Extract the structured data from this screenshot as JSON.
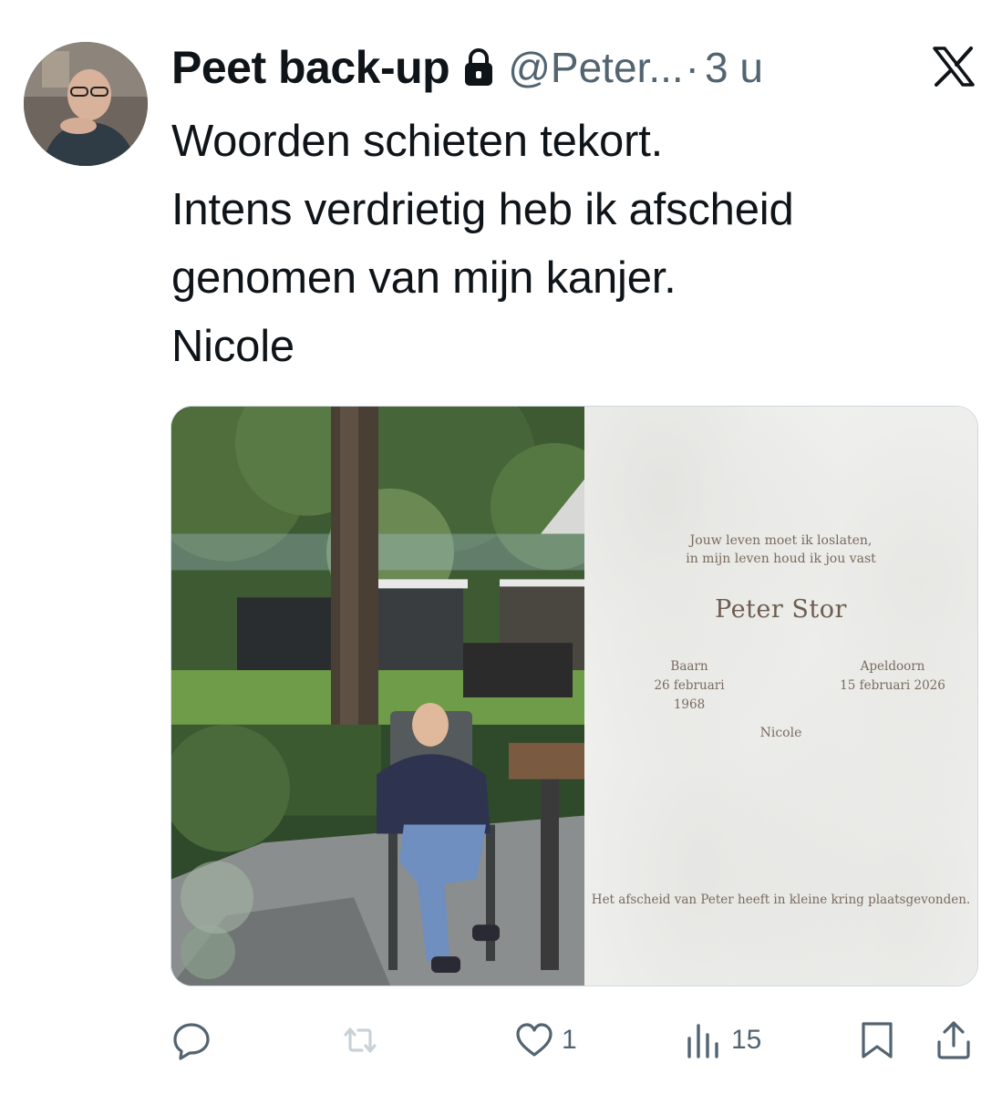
{
  "tweet": {
    "display_name": "Peet back-up",
    "handle": "@Peter...",
    "separator": "·",
    "time": "3 u",
    "text_lines": [
      "Woorden schieten tekort.",
      "Intens verdrietig heb ik afscheid",
      "genomen van mijn kanjer.",
      "Nicole"
    ]
  },
  "card": {
    "poem_line_1": "Jouw leven moet ik loslaten,",
    "poem_line_2": "in mijn leven houd ik jou vast",
    "name": "Peter Stor",
    "birth_place": "Baarn",
    "birth_date": "26 februari 1968",
    "death_place": "Apeldoorn",
    "death_date": "15 februari 2026",
    "signer": "Nicole",
    "closing": "Het afscheid van Peter heeft in kleine kring plaatsgevonden."
  },
  "actions": {
    "replies": "",
    "reposts": "",
    "likes": "1",
    "views": "15"
  },
  "icons": {
    "lock": "lock-icon",
    "x": "x-logo-icon",
    "reply": "reply-icon",
    "repost": "repost-icon",
    "like": "heart-icon",
    "views": "views-icon",
    "bookmark": "bookmark-icon",
    "share": "share-icon"
  },
  "colors": {
    "text": "#0f1419",
    "secondary": "#536471",
    "border": "#cfd9de"
  }
}
